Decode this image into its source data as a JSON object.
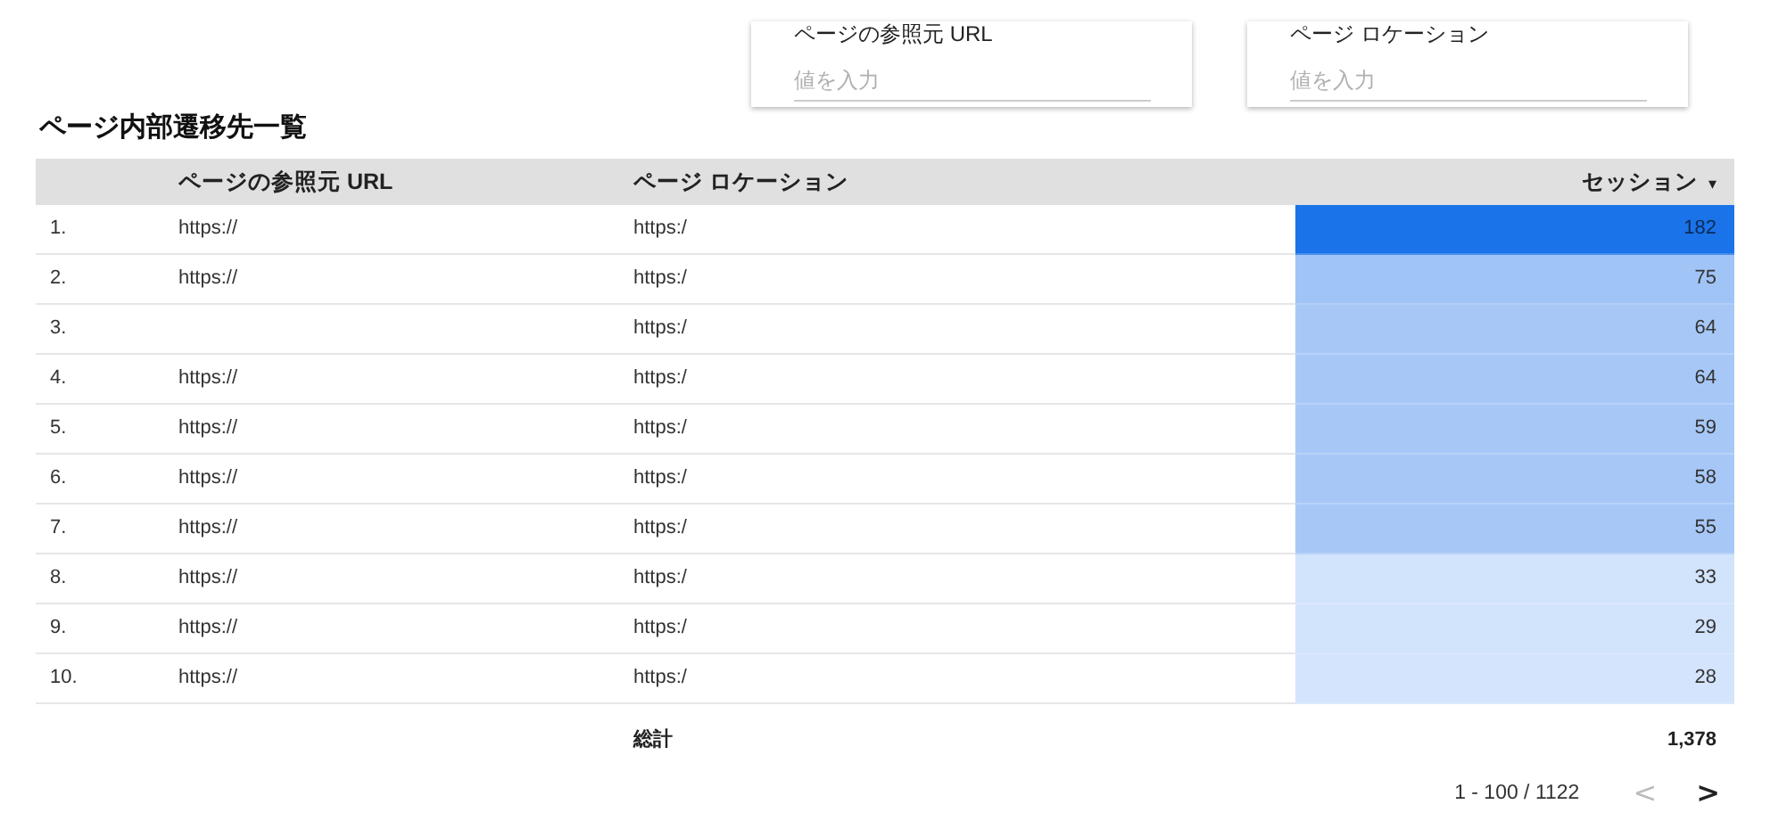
{
  "filters": [
    {
      "label": "ページの参照元 URL",
      "placeholder": "値を入力"
    },
    {
      "label": "ページ ロケーション",
      "placeholder": "値を入力"
    }
  ],
  "table": {
    "title": "ページ内部遷移先一覧",
    "columns": [
      {
        "label": "ページの参照元 URL"
      },
      {
        "label": "ページ ロケーション"
      },
      {
        "label": "セッション",
        "sort_icon": "▾"
      }
    ],
    "rows": [
      {
        "index": "1.",
        "referrer": "https://",
        "location": "https:/",
        "sessions": "182",
        "color": "#1a73e8"
      },
      {
        "index": "2.",
        "referrer": "https://",
        "location": "https:/",
        "sessions": "75",
        "color": "#a1c4f6"
      },
      {
        "index": "3.",
        "location": "https:/",
        "sessions": "64",
        "color": "#a7c8f7"
      },
      {
        "index": "4.",
        "referrer": "https://",
        "location": "https:/",
        "sessions": "64",
        "color": "#a7c8f7"
      },
      {
        "index": "5.",
        "referrer": "https://",
        "location": "https:/",
        "sessions": "59",
        "color": "#a7c8f7"
      },
      {
        "index": "6.",
        "referrer": "https://",
        "location": "https:/",
        "sessions": "58",
        "color": "#a7c8f7"
      },
      {
        "index": "7.",
        "referrer": "https://",
        "location": "https:/",
        "sessions": "55",
        "color": "#a7c8f7"
      },
      {
        "index": "8.",
        "referrer": "https://",
        "location": "https:/",
        "sessions": "33",
        "color": "#d2e3fc"
      },
      {
        "index": "9.",
        "referrer": "https://",
        "location": "https:/",
        "sessions": "29",
        "color": "#d2e3fc"
      },
      {
        "index": "10.",
        "referrer": "https://",
        "location": "https:/",
        "sessions": "28",
        "color": "#d4e4fc"
      }
    ],
    "total_label": "総計",
    "total": "1,378"
  },
  "pager": {
    "range": "1 - 100 / 1122",
    "prev": {
      "icon": "<",
      "disabled": true
    },
    "next": {
      "icon": ">",
      "disabled": false
    }
  }
}
